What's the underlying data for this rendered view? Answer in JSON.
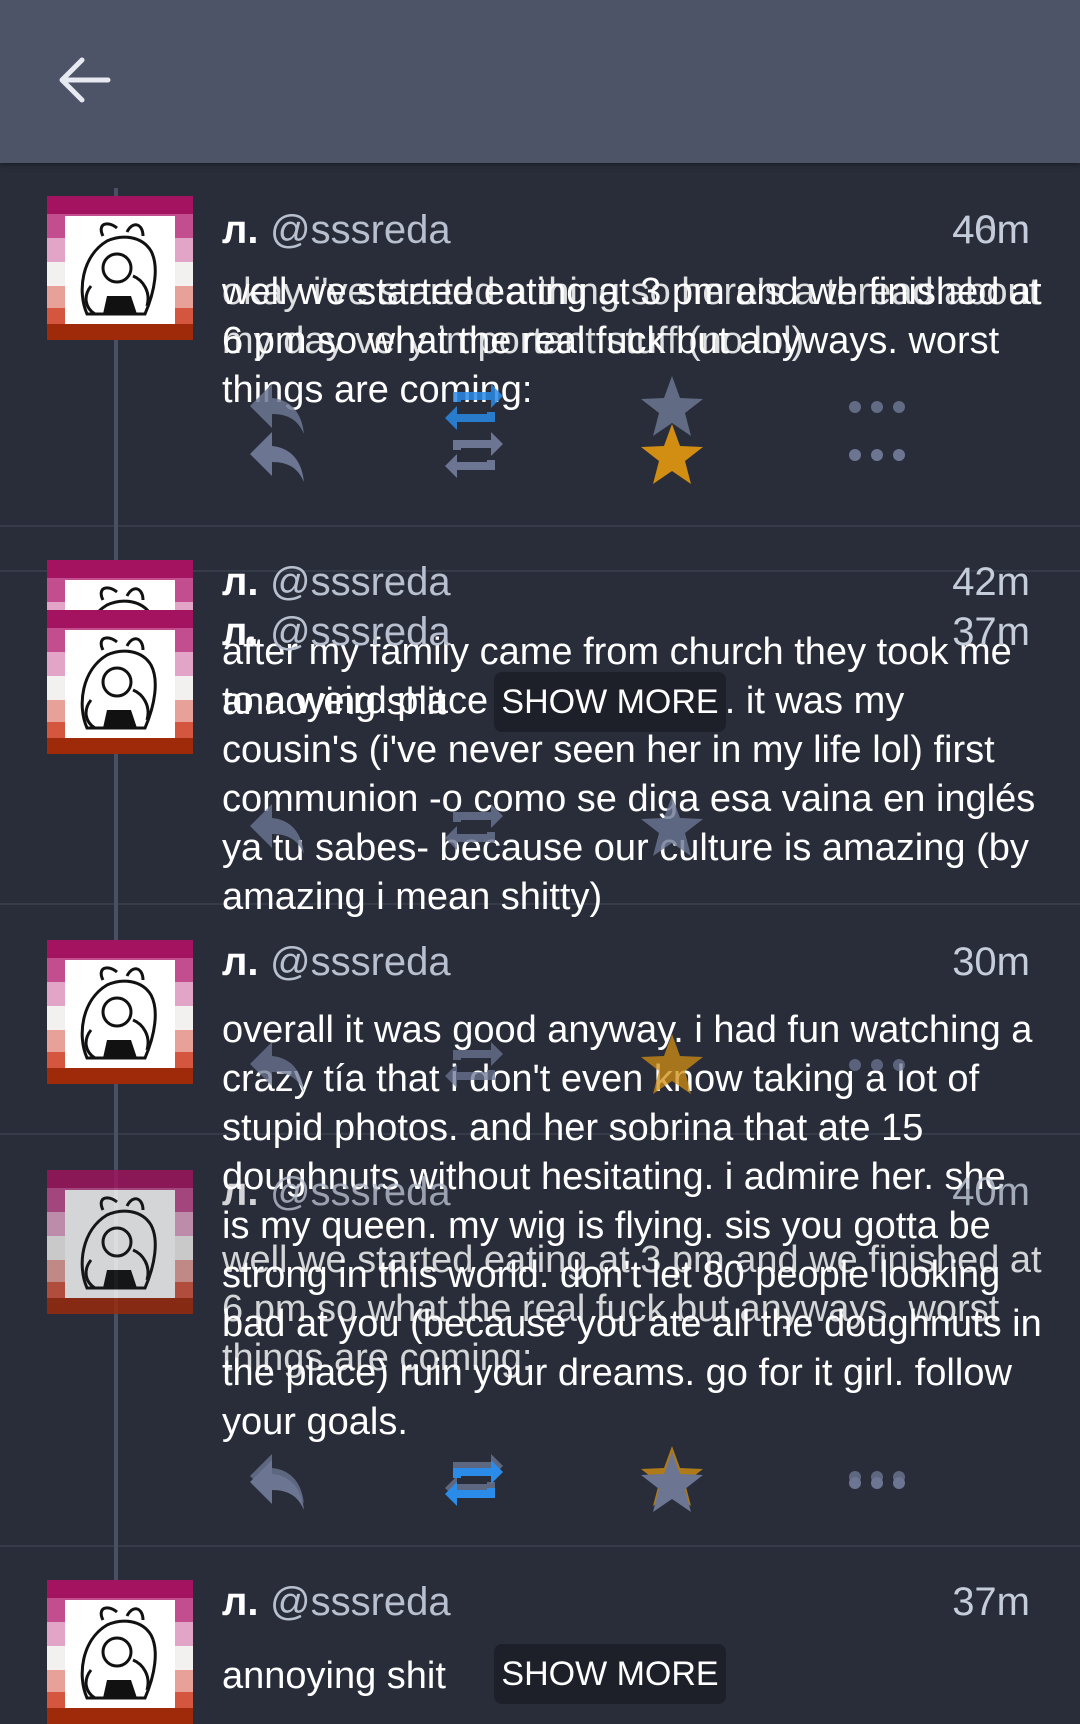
{
  "toolbar": {
    "back_icon": "arrow-left-icon"
  },
  "colors": {
    "appbar": "#4e5468",
    "background": "#292d39",
    "retweet_active": "#2a8be8",
    "favorite_active": "#d18e12",
    "icon_inactive": "#6c7693"
  },
  "tweets": [
    {
      "name": "л.",
      "handle": "@sssreda",
      "time": "40m",
      "text": "well we started eating at 3 pm and we finished at 6 pm so what the real fuck but anyways. worst things are coming:",
      "retweeted": true,
      "favorited": false
    },
    {
      "name": "л.",
      "handle": "@sssreda",
      "time": "46m",
      "text": "okay i've started a thing so here's a thread about my day very important stuff (no lol)",
      "retweeted": false,
      "favorited": true
    },
    {
      "name": "л.",
      "handle": "@sssreda",
      "time": "42m",
      "text": "after my family came from church they took me to a weird place to have lunch. it was my cousin's (i've never seen her in my life lol) first communion -o como se diga esa vaina en inglés ya tu sabes- because our culture is amazing (by amazing i mean shitty)",
      "retweeted": false,
      "favorited": false
    },
    {
      "name": "л.",
      "handle": "@sssreda",
      "time": "37m",
      "text": "annoying shit",
      "show_more": "SHOW MORE"
    },
    {
      "name": "л.",
      "handle": "@sssreda",
      "time": "30m",
      "text": "overall it was good anyway. i had fun watching a crazy tía that i don't even know taking a lot of stupid photos. and her sobrina that ate 15 doughnuts without hesitating. i admire her. she is my queen. my wig is flying. sis you gotta be strong in this world. don't let 80 people looking bad at you (because you ate all the doughnuts in the place) ruin your dreams. go for it girl. follow your goals.",
      "favorited": true
    },
    {
      "name": "л.",
      "handle": "@sssreda",
      "time": "40m",
      "text": "well we started eating at 3 pm and we finished at 6 pm so what the real fuck but anyways. worst things are coming:",
      "favorited": true
    },
    {
      "name": "л.",
      "handle": "@sssreda",
      "time": "37m",
      "text": "annoying shit",
      "show_more": "SHOW MORE",
      "retweeted": true
    }
  ]
}
